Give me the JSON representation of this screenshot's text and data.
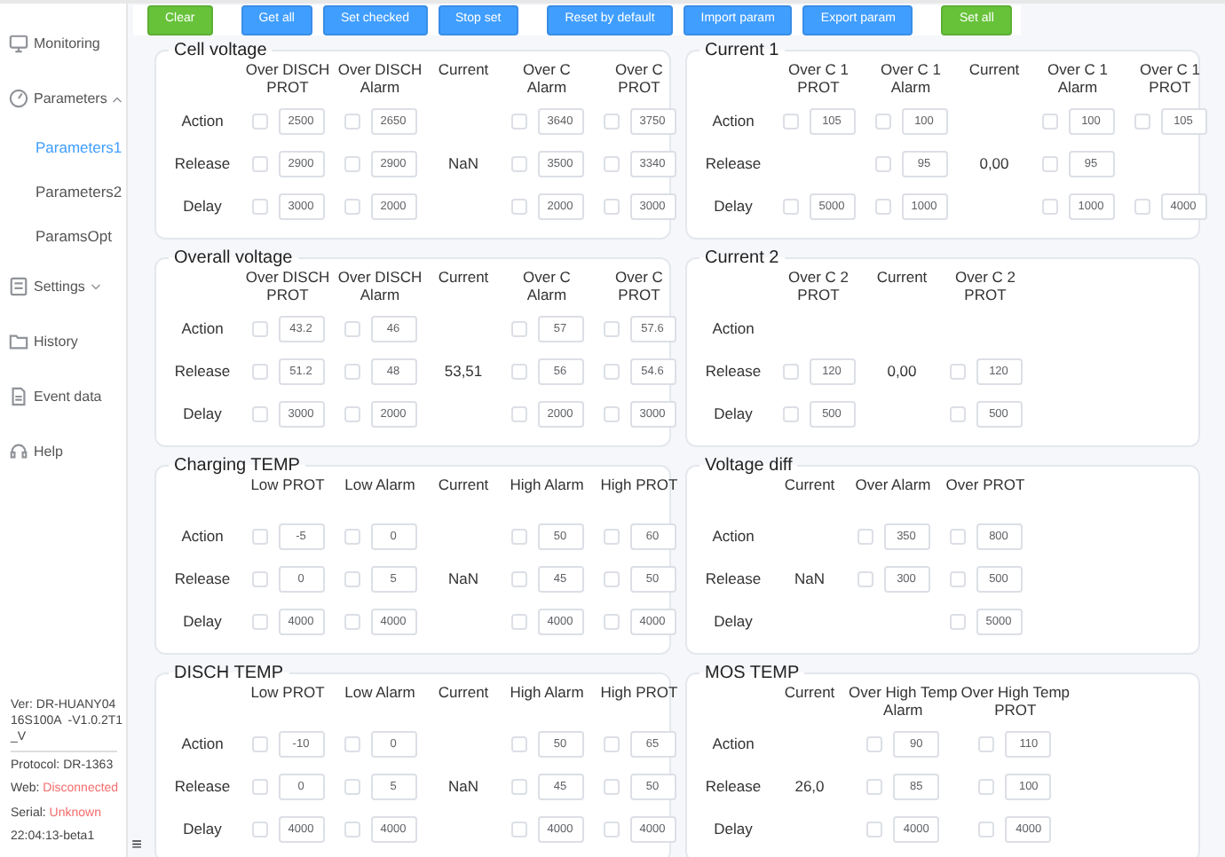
{
  "sidebar": {
    "menu": [
      {
        "label": "Monitoring",
        "selected": false
      },
      {
        "label": "Parameters",
        "selected": false,
        "expanded": true,
        "children": [
          {
            "label": "Parameters1",
            "selected": true
          },
          {
            "label": "Parameters2",
            "selected": false
          },
          {
            "label": "ParamsOpt",
            "selected": false
          }
        ]
      },
      {
        "label": "Settings",
        "selected": false,
        "expanded": false
      },
      {
        "label": "History",
        "selected": false
      },
      {
        "label": "Event data",
        "selected": false
      },
      {
        "label": "Help",
        "selected": false
      }
    ],
    "info": [
      {
        "kind": "plain",
        "text": "Ver: DR-HUANY04  16S100A  -V1.0.2T1_V"
      },
      {
        "kind": "divider"
      },
      {
        "kind": "pair",
        "label": "Protocol: ",
        "value": "DR-1363",
        "color": "#444444"
      },
      {
        "kind": "pair",
        "label": "Web: ",
        "value": "Disconnected",
        "color": "#f56c6c"
      },
      {
        "kind": "pair",
        "label": "Serial: ",
        "value": "Unknown",
        "color": "#f56c6c"
      },
      {
        "kind": "plain",
        "text": "22:04:13-beta1"
      }
    ],
    "menu_toggle": "≡"
  },
  "toolbar": [
    {
      "label": "Clear",
      "kind": "success"
    },
    {
      "label": "Get all",
      "kind": "primary"
    },
    {
      "label": "Set checked",
      "kind": "primary"
    },
    {
      "label": "Stop set",
      "kind": "primary"
    },
    {
      "label": "Reset by default",
      "kind": "primary"
    },
    {
      "label": "Import param",
      "kind": "primary"
    },
    {
      "label": "Export param",
      "kind": "primary"
    },
    {
      "label": "Set all",
      "kind": "success"
    }
  ],
  "left_panels": [
    {
      "title": "Cell voltage",
      "row_labels": [
        "Action",
        "Release",
        "Delay"
      ],
      "columns": [
        {
          "kind": "param",
          "header": "Over DISCH\nPROT",
          "cells": [
            {
              "value": "2500",
              "checked": false
            },
            {
              "value": "2900",
              "checked": false
            },
            {
              "value": "3000",
              "checked": false
            }
          ]
        },
        {
          "kind": "param",
          "header": "Over DISCH\nAlarm",
          "cells": [
            {
              "value": "2650",
              "checked": false
            },
            {
              "value": "2900",
              "checked": false
            },
            {
              "value": "2000",
              "checked": false
            }
          ]
        },
        {
          "kind": "current",
          "header": "Current",
          "value": "NaN"
        },
        {
          "kind": "param",
          "header": "Over C\nAlarm",
          "cells": [
            {
              "value": "3640",
              "checked": false
            },
            {
              "value": "3500",
              "checked": false
            },
            {
              "value": "2000",
              "checked": false
            }
          ]
        },
        {
          "kind": "param",
          "header": "Over C\nPROT",
          "cells": [
            {
              "value": "3750",
              "checked": false
            },
            {
              "value": "3340",
              "checked": false
            },
            {
              "value": "3000",
              "checked": false
            }
          ]
        }
      ]
    },
    {
      "title": "Overall voltage",
      "row_labels": [
        "Action",
        "Release",
        "Delay"
      ],
      "columns": [
        {
          "kind": "param",
          "header": "Over DISCH\nPROT",
          "cells": [
            {
              "value": "43.2",
              "checked": false
            },
            {
              "value": "51.2",
              "checked": false
            },
            {
              "value": "3000",
              "checked": false
            }
          ]
        },
        {
          "kind": "param",
          "header": "Over DISCH\nAlarm",
          "cells": [
            {
              "value": "46",
              "checked": false
            },
            {
              "value": "48",
              "checked": false
            },
            {
              "value": "2000",
              "checked": false
            }
          ]
        },
        {
          "kind": "current",
          "header": "Current",
          "value": "53,51"
        },
        {
          "kind": "param",
          "header": "Over C\nAlarm",
          "cells": [
            {
              "value": "57",
              "checked": false
            },
            {
              "value": "56",
              "checked": false
            },
            {
              "value": "2000",
              "checked": false
            }
          ]
        },
        {
          "kind": "param",
          "header": "Over C\nPROT",
          "cells": [
            {
              "value": "57.6",
              "checked": false
            },
            {
              "value": "54.6",
              "checked": false
            },
            {
              "value": "3000",
              "checked": false
            }
          ]
        }
      ]
    },
    {
      "title": "Charging TEMP",
      "row_labels": [
        "Action",
        "Release",
        "Delay"
      ],
      "columns": [
        {
          "kind": "param",
          "header": "Low PROT",
          "cells": [
            {
              "value": "-5",
              "checked": false
            },
            {
              "value": "0",
              "checked": false
            },
            {
              "value": "4000",
              "checked": false
            }
          ]
        },
        {
          "kind": "param",
          "header": "Low Alarm",
          "cells": [
            {
              "value": "0",
              "checked": false
            },
            {
              "value": "5",
              "checked": false
            },
            {
              "value": "4000",
              "checked": false
            }
          ]
        },
        {
          "kind": "current",
          "header": "Current",
          "value": "NaN"
        },
        {
          "kind": "param",
          "header": "High Alarm",
          "cells": [
            {
              "value": "50",
              "checked": false
            },
            {
              "value": "45",
              "checked": false
            },
            {
              "value": "4000",
              "checked": false
            }
          ]
        },
        {
          "kind": "param",
          "header": "High PROT",
          "cells": [
            {
              "value": "60",
              "checked": false
            },
            {
              "value": "50",
              "checked": false
            },
            {
              "value": "4000",
              "checked": false
            }
          ]
        }
      ]
    },
    {
      "title": "DISCH TEMP",
      "row_labels": [
        "Action",
        "Release",
        "Delay"
      ],
      "columns": [
        {
          "kind": "param",
          "header": "Low PROT",
          "cells": [
            {
              "value": "-10",
              "checked": false
            },
            {
              "value": "0",
              "checked": false
            },
            {
              "value": "4000",
              "checked": false
            }
          ]
        },
        {
          "kind": "param",
          "header": "Low Alarm",
          "cells": [
            {
              "value": "0",
              "checked": false
            },
            {
              "value": "5",
              "checked": false
            },
            {
              "value": "4000",
              "checked": false
            }
          ]
        },
        {
          "kind": "current",
          "header": "Current",
          "value": "NaN"
        },
        {
          "kind": "param",
          "header": "High Alarm",
          "cells": [
            {
              "value": "50",
              "checked": false
            },
            {
              "value": "45",
              "checked": false
            },
            {
              "value": "4000",
              "checked": false
            }
          ]
        },
        {
          "kind": "param",
          "header": "High PROT",
          "cells": [
            {
              "value": "65",
              "checked": false
            },
            {
              "value": "50",
              "checked": false
            },
            {
              "value": "4000",
              "checked": false
            }
          ]
        }
      ]
    }
  ],
  "right_panels": [
    {
      "title": "Current 1",
      "row_labels": [
        "Action",
        "Release",
        "Delay"
      ],
      "columns": [
        {
          "kind": "param",
          "header": "Over C 1\nPROT",
          "cells": [
            {
              "value": "105",
              "checked": false
            },
            null,
            {
              "value": "5000",
              "checked": false
            }
          ]
        },
        {
          "kind": "param",
          "header": "Over C 1\nAlarm",
          "cells": [
            {
              "value": "100",
              "checked": false
            },
            {
              "value": "95",
              "checked": false
            },
            {
              "value": "1000",
              "checked": false
            }
          ]
        },
        {
          "kind": "current",
          "header": "Current",
          "value": "0,00"
        },
        {
          "kind": "param",
          "header": "Over C 1\nAlarm",
          "cells": [
            {
              "value": "100",
              "checked": false
            },
            {
              "value": "95",
              "checked": false
            },
            {
              "value": "1000",
              "checked": false
            }
          ]
        },
        {
          "kind": "param",
          "header": "Over C 1\nPROT",
          "cells": [
            {
              "value": "105",
              "checked": false
            },
            null,
            {
              "value": "4000",
              "checked": false
            }
          ]
        }
      ]
    },
    {
      "title": "Current 2",
      "row_labels": [
        "Action",
        "Release",
        "Delay"
      ],
      "columns": [
        {
          "kind": "param",
          "header": "Over C 2\nPROT",
          "cells": [
            null,
            {
              "value": "120",
              "checked": false
            },
            {
              "value": "500",
              "checked": false
            }
          ]
        },
        {
          "kind": "current",
          "header": "Current",
          "value": "0,00"
        },
        {
          "kind": "param",
          "header": "Over C 2\nPROT",
          "cells": [
            null,
            {
              "value": "120",
              "checked": false
            },
            {
              "value": "500",
              "checked": false
            }
          ]
        }
      ]
    },
    {
      "title": "Voltage diff",
      "row_labels": [
        "Action",
        "Release",
        "Delay"
      ],
      "columns": [
        {
          "kind": "current",
          "header": "Current",
          "value": "NaN"
        },
        {
          "kind": "param",
          "header": "Over Alarm",
          "cells": [
            {
              "value": "350",
              "checked": false
            },
            {
              "value": "300",
              "checked": false
            },
            null
          ]
        },
        {
          "kind": "param",
          "header": "Over PROT",
          "cells": [
            {
              "value": "800",
              "checked": false
            },
            {
              "value": "500",
              "checked": false
            },
            {
              "value": "5000",
              "checked": false
            }
          ]
        }
      ]
    },
    {
      "title": "MOS TEMP",
      "row_labels": [
        "Action",
        "Release",
        "Delay"
      ],
      "columns": [
        {
          "kind": "current",
          "header": "Current",
          "value": "26,0"
        },
        {
          "kind": "param",
          "header": "Over High Temp\nAlarm",
          "cells": [
            {
              "value": "90",
              "checked": false
            },
            {
              "value": "85",
              "checked": false
            },
            {
              "value": "4000",
              "checked": false
            }
          ]
        },
        {
          "kind": "param",
          "header": "Over High Temp\nPROT",
          "cells": [
            {
              "value": "110",
              "checked": false
            },
            {
              "value": "100",
              "checked": false
            },
            {
              "value": "4000",
              "checked": false
            }
          ]
        }
      ]
    }
  ]
}
